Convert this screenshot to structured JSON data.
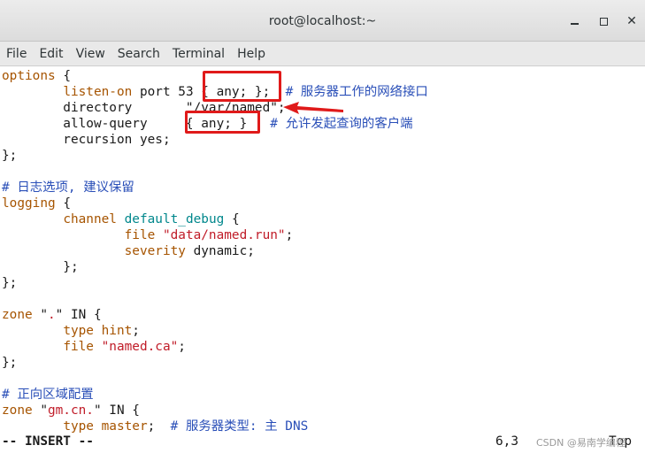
{
  "window": {
    "title": "root@localhost:~",
    "minimize_icon": "minimize-icon",
    "maximize_icon": "maximize-icon",
    "close_icon": "close-icon",
    "close_glyph": "✕"
  },
  "menu": {
    "items": [
      "File",
      "Edit",
      "View",
      "Search",
      "Terminal",
      "Help"
    ]
  },
  "editor": {
    "lines": [
      [
        {
          "t": "options",
          "c": "kw-brown"
        },
        {
          "t": " {",
          "c": "plain"
        }
      ],
      [
        {
          "t": "        ",
          "c": "plain"
        },
        {
          "t": "listen-on",
          "c": "kw-brown"
        },
        {
          "t": " port 53 { any; };  ",
          "c": "plain"
        },
        {
          "t": "# 服务器工作的网络接口",
          "c": "cmt"
        }
      ],
      [
        {
          "t": "        directory       \"/var/named\";",
          "c": "plain"
        }
      ],
      [
        {
          "t": "        allow-query     { any; }   ",
          "c": "plain"
        },
        {
          "t": "# 允许发起查询的客户端",
          "c": "cmt"
        }
      ],
      [
        {
          "t": "        recursion yes;",
          "c": "plain"
        }
      ],
      [
        {
          "t": "};",
          "c": "plain"
        }
      ],
      [
        {
          "t": "",
          "c": "plain"
        }
      ],
      [
        {
          "t": "# 日志选项, 建议保留",
          "c": "cmt"
        }
      ],
      [
        {
          "t": "logging",
          "c": "kw-brown"
        },
        {
          "t": " {",
          "c": "plain"
        }
      ],
      [
        {
          "t": "        ",
          "c": "plain"
        },
        {
          "t": "channel",
          "c": "kw-brown"
        },
        {
          "t": " ",
          "c": "plain"
        },
        {
          "t": "default_debug",
          "c": "kw-teal"
        },
        {
          "t": " {",
          "c": "plain"
        }
      ],
      [
        {
          "t": "                ",
          "c": "plain"
        },
        {
          "t": "file",
          "c": "kw-brown"
        },
        {
          "t": " ",
          "c": "plain"
        },
        {
          "t": "\"data/named.run\"",
          "c": "str-red"
        },
        {
          "t": ";",
          "c": "plain"
        }
      ],
      [
        {
          "t": "                ",
          "c": "plain"
        },
        {
          "t": "severity",
          "c": "kw-brown"
        },
        {
          "t": " dynamic;",
          "c": "plain"
        }
      ],
      [
        {
          "t": "        };",
          "c": "plain"
        }
      ],
      [
        {
          "t": "};",
          "c": "plain"
        }
      ],
      [
        {
          "t": "",
          "c": "plain"
        }
      ],
      [
        {
          "t": "zone",
          "c": "kw-brown"
        },
        {
          "t": " \"",
          "c": "plain"
        },
        {
          "t": ".",
          "c": "str-red"
        },
        {
          "t": "\" IN {",
          "c": "plain"
        }
      ],
      [
        {
          "t": "        ",
          "c": "plain"
        },
        {
          "t": "type",
          "c": "kw-brown"
        },
        {
          "t": " ",
          "c": "plain"
        },
        {
          "t": "hint",
          "c": "kw-brown"
        },
        {
          "t": ";",
          "c": "plain"
        }
      ],
      [
        {
          "t": "        ",
          "c": "plain"
        },
        {
          "t": "file",
          "c": "kw-brown"
        },
        {
          "t": " ",
          "c": "plain"
        },
        {
          "t": "\"named.ca\"",
          "c": "str-red"
        },
        {
          "t": ";",
          "c": "plain"
        }
      ],
      [
        {
          "t": "};",
          "c": "plain"
        }
      ],
      [
        {
          "t": "",
          "c": "plain"
        }
      ],
      [
        {
          "t": "# 正向区域配置",
          "c": "cmt"
        }
      ],
      [
        {
          "t": "zone",
          "c": "kw-brown"
        },
        {
          "t": " \"",
          "c": "plain"
        },
        {
          "t": "gm.cn.",
          "c": "str-red"
        },
        {
          "t": "\" IN {",
          "c": "plain"
        }
      ],
      [
        {
          "t": "        ",
          "c": "plain"
        },
        {
          "t": "type",
          "c": "kw-brown"
        },
        {
          "t": " ",
          "c": "plain"
        },
        {
          "t": "master",
          "c": "kw-brown"
        },
        {
          "t": ";  ",
          "c": "plain"
        },
        {
          "t": "# 服务器类型: 主 DNS",
          "c": "cmt"
        }
      ]
    ]
  },
  "status": {
    "mode": "-- INSERT --",
    "cursor": "6,3",
    "scroll": "Top",
    "watermark": "CSDN @易南学编程"
  },
  "annotation_colors": {
    "highlight": "#e01a1a"
  }
}
